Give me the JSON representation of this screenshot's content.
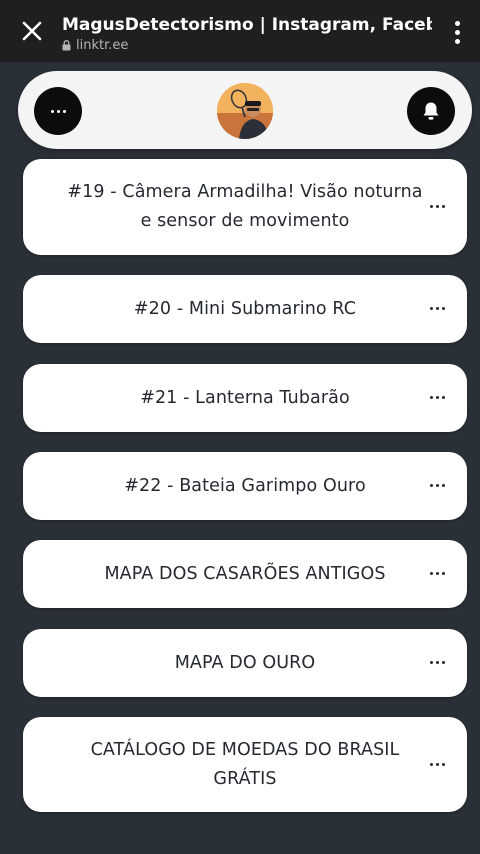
{
  "browser": {
    "title": "MagusDetectorismo | Instagram, Facebook |",
    "url": "linktr.ee"
  },
  "header": {
    "menu_icon": "more-horizontal-icon",
    "bell_icon": "bell-icon",
    "avatar": "profile-avatar"
  },
  "links": [
    {
      "label": "#19 - Câmera Armadilha! Visão noturna e sensor de movimento"
    },
    {
      "label": "#20 - Mini Submarino RC"
    },
    {
      "label": "#21 - Lanterna Tubarão"
    },
    {
      "label": "#22 - Bateia Garimpo Ouro"
    },
    {
      "label": "MAPA DOS CASARÕES ANTIGOS"
    },
    {
      "label": "MAPA DO OURO"
    },
    {
      "label": "CATÁLOGO DE MOEDAS DO BRASIL GRÁTIS"
    }
  ],
  "colors": {
    "page_background": "#2a3037",
    "browser_bar": "#1f1f1f",
    "card_background": "#ffffff",
    "card_text": "#252a31"
  }
}
